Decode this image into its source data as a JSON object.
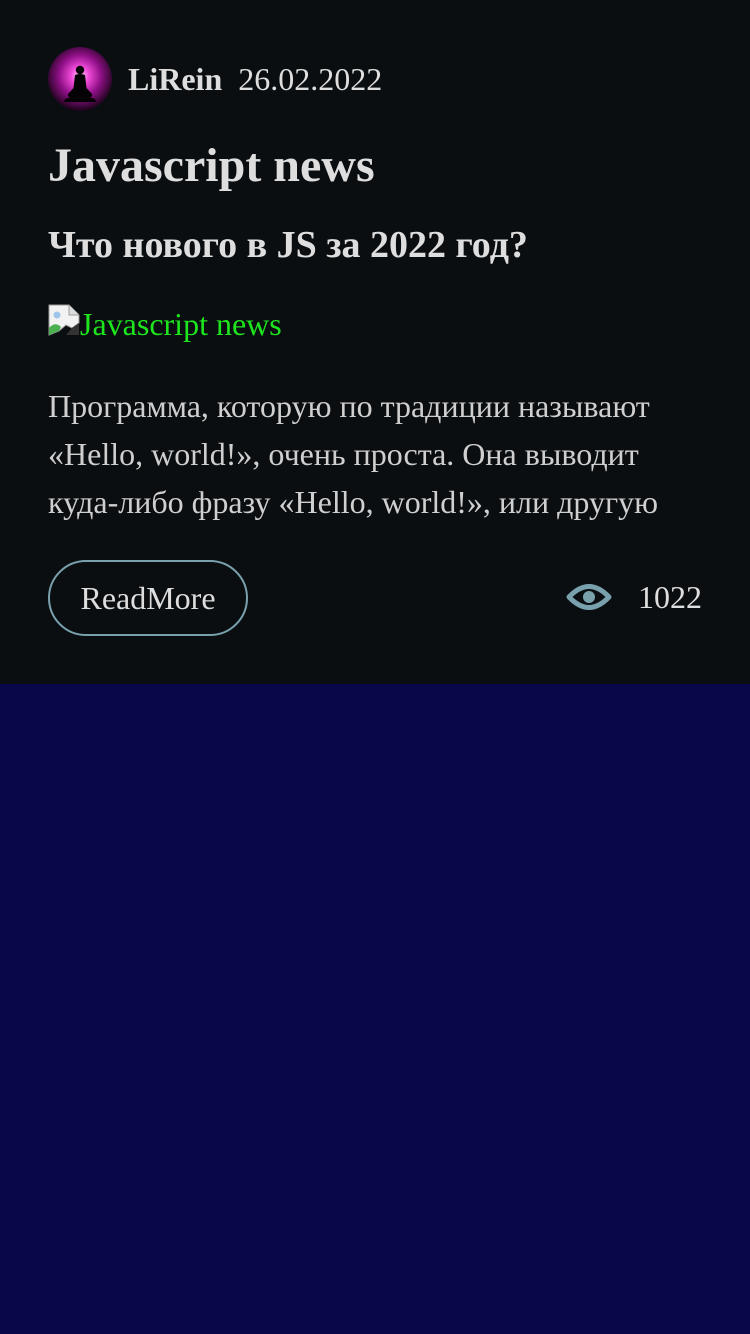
{
  "post": {
    "author": {
      "name": "LiRein",
      "avatar_icon": "meditation-silhouette-avatar"
    },
    "date": "26.02.2022",
    "title": "Javascript news",
    "subtitle": "Что нового в JS за 2022 год?",
    "image": {
      "alt": "Javascript news",
      "icon": "broken-image-icon"
    },
    "excerpt_lines": [
      "Программа, которую по традиции называют",
      "«Hello, world!», очень проста. Она выводит",
      "куда-либо фразу «Hello, world!», или другую"
    ],
    "read_more_label": "ReadMore",
    "views": {
      "icon": "eye-icon",
      "count": "1022"
    }
  },
  "colors": {
    "page_background": "#09074a",
    "card_background": "#0a0e11",
    "text": "#dedede",
    "alt_text": "#1ee61e",
    "accent_outline": "#79a1ad",
    "avatar_glow": "#e020c8"
  }
}
